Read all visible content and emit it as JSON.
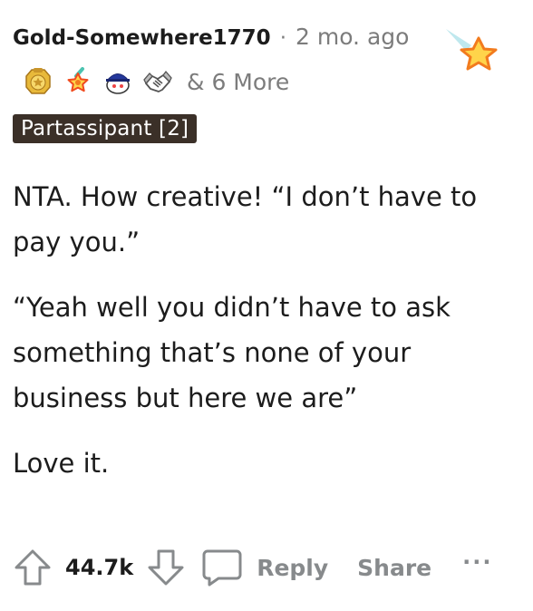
{
  "comment": {
    "username": "Gold-Somewhere1770",
    "separator": "·",
    "time": "2 mo. ago",
    "awards": [
      {
        "icon": "gold-award-icon"
      },
      {
        "icon": "star-award-icon"
      },
      {
        "icon": "snoo-cap-award-icon"
      },
      {
        "icon": "handshake-award-icon"
      }
    ],
    "more_awards": "& 6 More",
    "flair": "Partassipant [2]",
    "paragraphs": [
      "NTA. How creative! “I don’t have to pay you.”",
      "“Yeah well you didn’t have to ask something that’s none of your business but here we are”",
      "Love it."
    ]
  },
  "actions": {
    "score": "44.7k",
    "reply_label": "Reply",
    "share_label": "Share",
    "more_label": "···"
  },
  "colors": {
    "text": "#1c1c1c",
    "muted": "#7c7c7c",
    "action_gray": "#878a8c",
    "flair_bg": "#3b3028",
    "star_fill": "#ffd44a",
    "star_stroke": "#f27b1e"
  }
}
